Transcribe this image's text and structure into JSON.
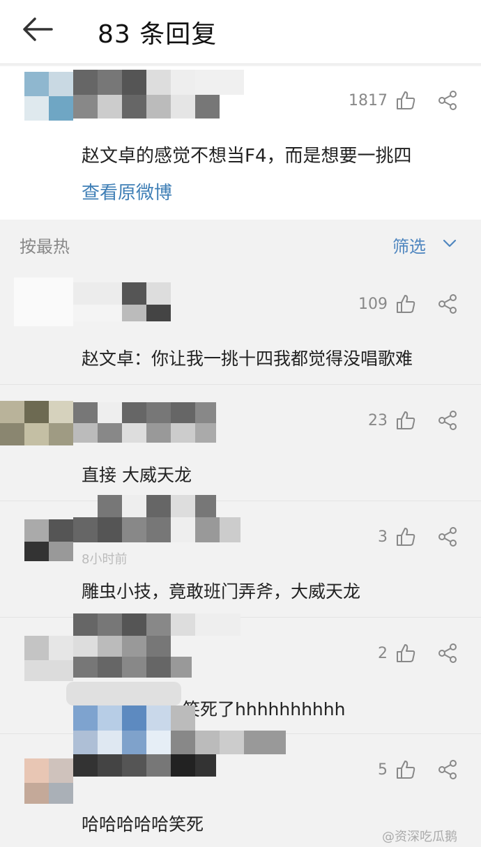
{
  "header": {
    "title": "83 条回复"
  },
  "original": {
    "likes": "1817",
    "text": "赵文卓的感觉不想当F4，而是想要一挑四",
    "view_link": "查看原微博"
  },
  "sortbar": {
    "sort_label": "按最热",
    "filter_label": "筛选"
  },
  "comments": [
    {
      "likes": "109",
      "text": "赵文卓：你让我一挑十四我都觉得没唱歌难"
    },
    {
      "likes": "23",
      "text": "直接 大威天龙"
    },
    {
      "likes": "3",
      "text": "雕虫小技，竟敢班门弄斧，大威天龙",
      "timestamp": "8小时前"
    },
    {
      "likes": "2",
      "text": "笑死了hhhhhhhhhh"
    },
    {
      "likes": "5",
      "text": "哈哈哈哈哈笑死"
    }
  ],
  "watermark": "@资深吃瓜鹅",
  "colors": {
    "link": "#3f7fb6",
    "filter": "#4f86bf",
    "muted": "#888888"
  }
}
